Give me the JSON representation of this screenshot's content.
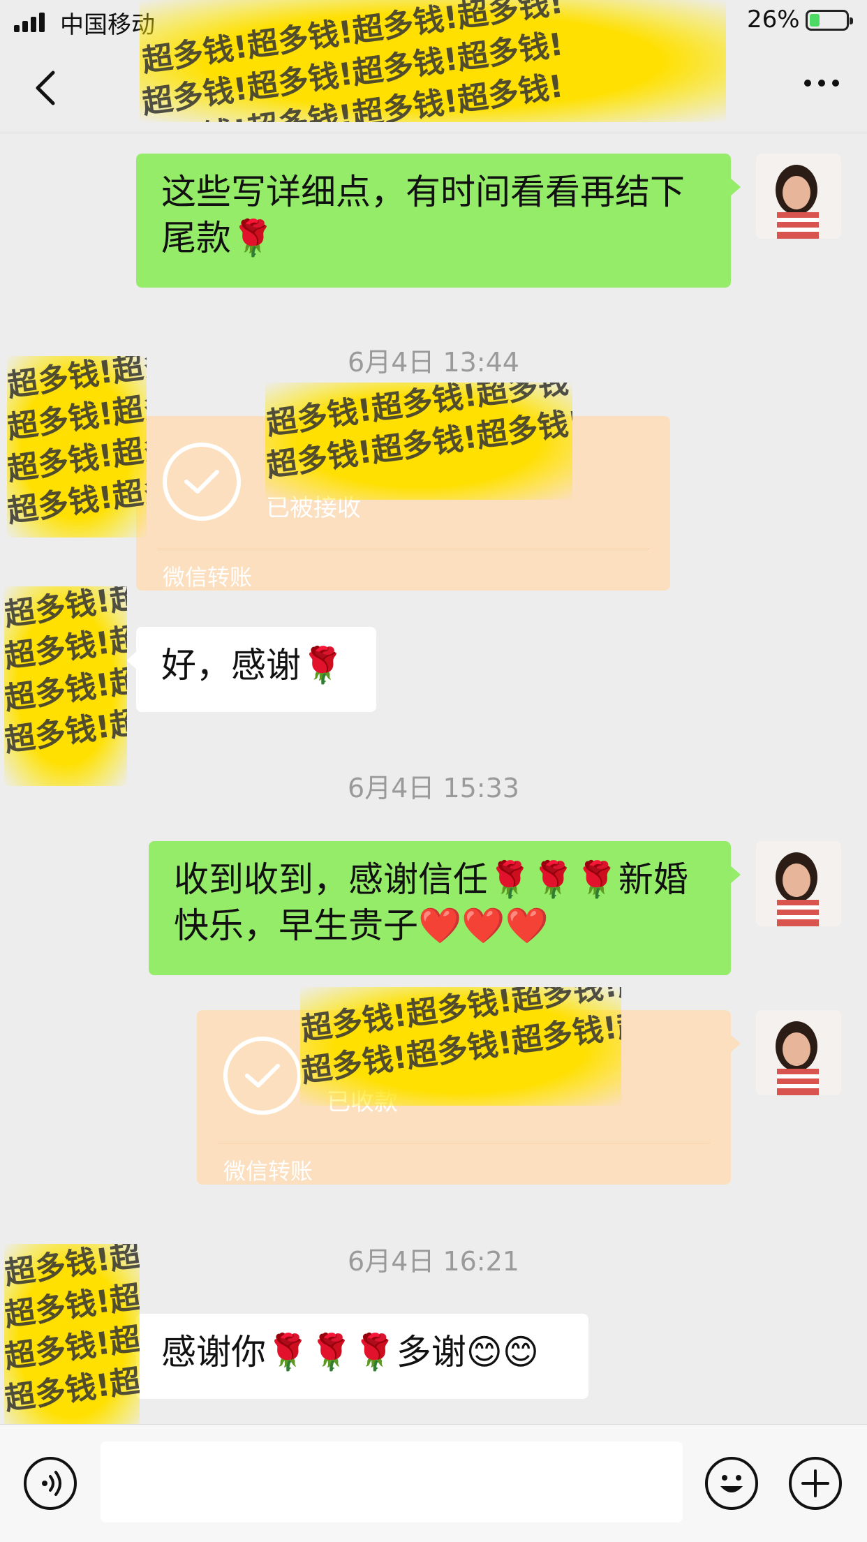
{
  "status": {
    "carrier": "中国移动",
    "battery": "26%"
  },
  "nav": {
    "back_icon": "chevron-left-icon",
    "more_icon": "more-dots-icon"
  },
  "watermark_text": "超多钱!超多钱!超多钱!超多钱!",
  "messages": {
    "m1": "这些写详细点，有时间看看再结下尾款🌹",
    "t1": "6月4日 13:44",
    "tr1_status": "已被接收",
    "tr1_label": "微信转账",
    "m2": "好，感谢🌹",
    "t2": "6月4日 15:33",
    "m3": "收到收到，感谢信任🌹🌹🌹新婚快乐，早生贵子❤️❤️❤️",
    "tr2_status": "已收款",
    "tr2_label": "微信转账",
    "t3": "6月4日 16:21",
    "m4": "感谢你🌹🌹🌹多谢😊😊"
  },
  "colors": {
    "sent_bubble": "#95ec69",
    "received_bubble": "#ffffff",
    "transfer": "#fbdfbe",
    "watermark": "#ffdf00"
  },
  "input_bar": {
    "voice_icon": "voice-icon",
    "emoji_icon": "emoji-icon",
    "plus_icon": "plus-icon"
  }
}
